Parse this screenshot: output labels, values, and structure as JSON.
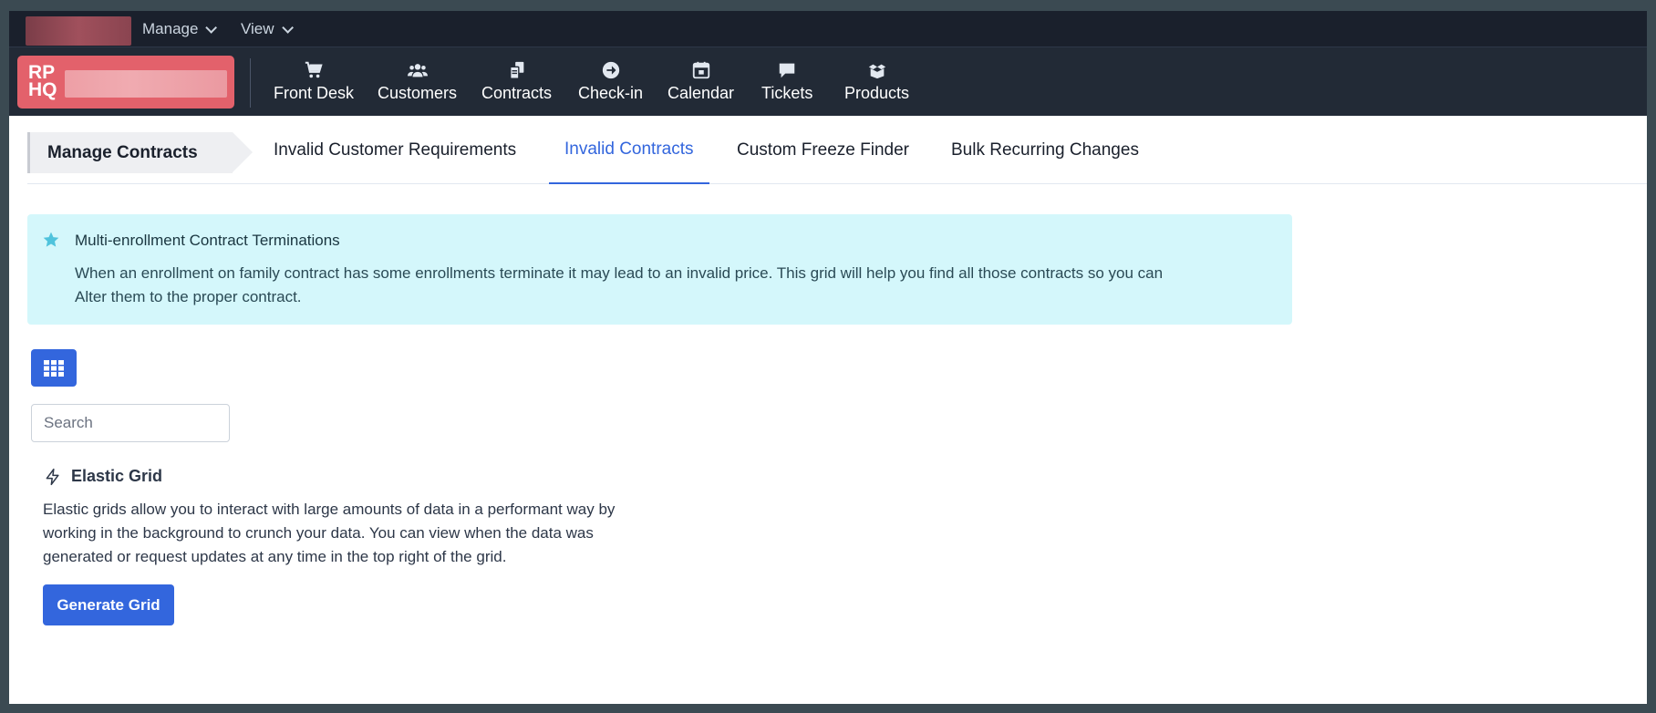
{
  "menubar": {
    "items": [
      {
        "label": "Manage"
      },
      {
        "label": "View"
      }
    ]
  },
  "logo": {
    "text_line1": "RP",
    "text_line2": "HQ"
  },
  "nav": {
    "items": [
      {
        "label": "Front Desk",
        "icon": "cart-icon"
      },
      {
        "label": "Customers",
        "icon": "users-icon"
      },
      {
        "label": "Contracts",
        "icon": "documents-icon"
      },
      {
        "label": "Check-in",
        "icon": "arrow-circle-icon"
      },
      {
        "label": "Calendar",
        "icon": "calendar-icon"
      },
      {
        "label": "Tickets",
        "icon": "comment-icon"
      },
      {
        "label": "Products",
        "icon": "boxes-icon"
      }
    ]
  },
  "tabs": {
    "section_title": "Manage Contracts",
    "items": [
      {
        "label": "Invalid Customer Requirements",
        "active": false
      },
      {
        "label": "Invalid Contracts",
        "active": true
      },
      {
        "label": "Custom Freeze Finder",
        "active": false
      },
      {
        "label": "Bulk Recurring Changes",
        "active": false
      }
    ]
  },
  "alert": {
    "icon": "star-icon",
    "title": "Multi-enrollment Contract Terminations",
    "body_line1": "When an enrollment on family contract has some enrollments terminate it may lead to an invalid price. This grid will help you find all those contracts so you can",
    "body_line2": "Alter them to the proper contract."
  },
  "search": {
    "placeholder": "Search",
    "value": ""
  },
  "elastic": {
    "icon": "lightning-icon",
    "title": "Elastic Grid",
    "body_line1": "Elastic grids allow you to interact with large amounts of data in a performant way by",
    "body_line2": "working in the background to crunch your data. You can view when the data was",
    "body_line3": "generated or request updates at any time in the top right of the grid.",
    "button_label": "Generate Grid"
  },
  "colors": {
    "accent": "#3366dd",
    "logo": "#e3616b",
    "alert_bg": "#d4f7fb",
    "navbar": "#222a36"
  }
}
